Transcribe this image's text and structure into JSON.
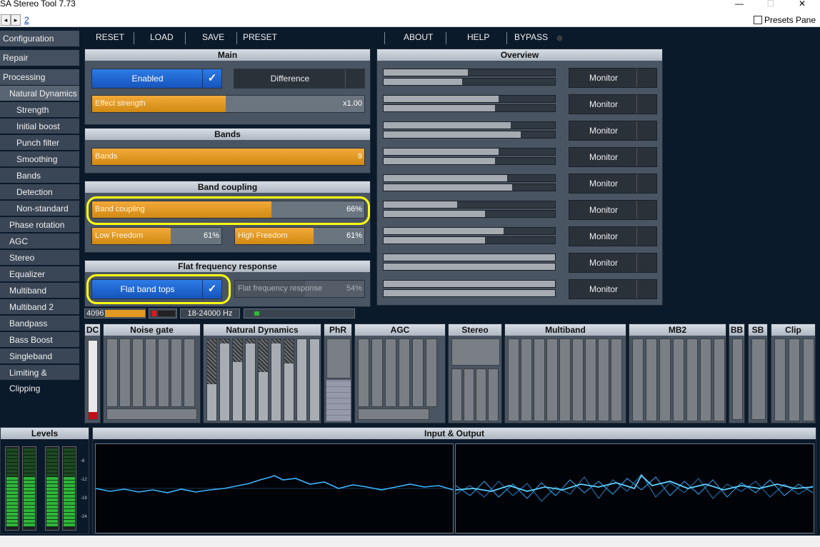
{
  "window": {
    "title": "SA Stereo Tool 7.73",
    "min": "—",
    "max": "☐",
    "close": "✕"
  },
  "topbar": {
    "back": "◂",
    "forward": "▸",
    "page_link": "2",
    "presets_pane": "Presets Pane"
  },
  "nav": [
    {
      "label": "Configuration",
      "level": 0
    },
    {
      "label": "Repair",
      "level": 0
    },
    {
      "label": "Processing",
      "level": 0
    },
    {
      "label": "Natural Dynamics",
      "level": 1,
      "active": true
    },
    {
      "label": "Strength",
      "level": 2
    },
    {
      "label": "Initial boost",
      "level": 2
    },
    {
      "label": "Punch filter",
      "level": 2
    },
    {
      "label": "Smoothing",
      "level": 2
    },
    {
      "label": "Bands",
      "level": 2
    },
    {
      "label": "Detection",
      "level": 2
    },
    {
      "label": "Non-standard",
      "level": 2
    },
    {
      "label": "Phase rotation",
      "level": 1
    },
    {
      "label": "AGC",
      "level": 1
    },
    {
      "label": "Stereo",
      "level": 1
    },
    {
      "label": "Equalizer",
      "level": 1
    },
    {
      "label": "Multiband",
      "level": 1
    },
    {
      "label": "Multiband 2",
      "level": 1
    },
    {
      "label": "Bandpass",
      "level": 1
    },
    {
      "label": "Bass Boost",
      "level": 1
    },
    {
      "label": "Singleband",
      "level": 1
    },
    {
      "label": "Limiting & Clipping",
      "level": 1
    }
  ],
  "menu": {
    "reset": "RESET",
    "load": "LOAD",
    "save": "SAVE",
    "preset": "PRESET",
    "about": "ABOUT",
    "help": "HELP",
    "bypass": "BYPASS"
  },
  "main": {
    "title": "Main",
    "enabled_label": "Enabled",
    "enabled_checked": true,
    "difference_label": "Difference",
    "difference_checked": false,
    "effect_strength": {
      "label": "Effect strength",
      "value": "x1.00",
      "fill": 0.49
    }
  },
  "bands": {
    "title": "Bands",
    "slider": {
      "label": "Bands",
      "value": "9",
      "fill": 1.0
    }
  },
  "band_coupling": {
    "title": "Band coupling",
    "coupling": {
      "label": "Band coupling",
      "value": "66%",
      "fill": 0.66
    },
    "low_freedom": {
      "label": "Low Freedom",
      "value": "61%",
      "fill": 0.61
    },
    "high_freedom": {
      "label": "High Freedom",
      "value": "61%",
      "fill": 0.61
    }
  },
  "flat": {
    "title": "Flat frequency response",
    "tops_label": "Flat band tops",
    "tops_checked": true,
    "response": {
      "label": "Flat frequency response",
      "value": "54%",
      "fill": 0.54
    }
  },
  "overview": {
    "title": "Overview",
    "monitor_label": "Monitor",
    "rows": [
      [
        0.49,
        0.46
      ],
      [
        0.67,
        0.65
      ],
      [
        0.74,
        0.8
      ],
      [
        0.67,
        0.65
      ],
      [
        0.72,
        0.75
      ],
      [
        0.43,
        0.59
      ],
      [
        0.7,
        0.59
      ],
      [
        1.0,
        1.0
      ],
      [
        1.0,
        1.0
      ]
    ]
  },
  "status": {
    "block": "4096",
    "freq": "18-24000 Hz"
  },
  "modules": {
    "dc": "DC",
    "noise_gate": "Noise gate",
    "natural_dynamics": "Natural Dynamics",
    "phr": "PhR",
    "agc": "AGC",
    "stereo": "Stereo",
    "multiband": "Multiband",
    "mb2": "MB2",
    "bb": "BB",
    "sb": "SB",
    "clip": "Clip"
  },
  "levels": {
    "title": "Levels",
    "ticks": [
      "-6",
      "-12",
      "-18",
      "-24"
    ]
  },
  "io": {
    "title": "Input & Output"
  },
  "colors": {
    "accent_orange": "#f2a93a",
    "blue": "#1f6ad6",
    "highlight": "#ffff10",
    "trace": "#3ab4ff"
  }
}
